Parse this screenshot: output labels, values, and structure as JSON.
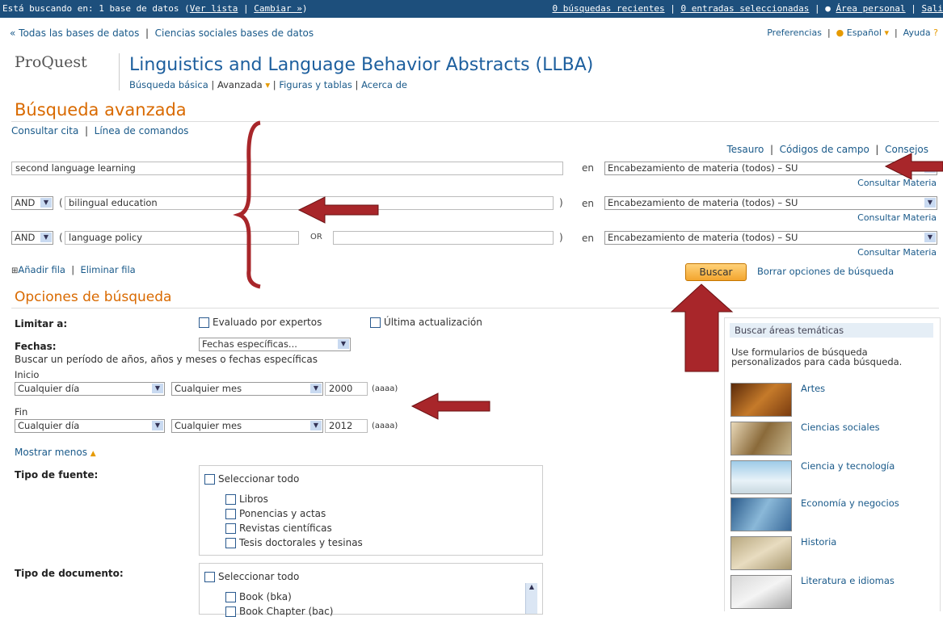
{
  "topbar": {
    "searching_prefix": "Está buscando en: 1 base de datos (",
    "ver_lista": "Ver lista",
    "sep": " | ",
    "cambiar": "Cambiar »",
    "searching_suffix": ")",
    "recent": "0 búsquedas recientes",
    "selected": "0 entradas seleccionadas",
    "personal": "Área personal",
    "exit": "Sali"
  },
  "nav": {
    "all_db": "« Todas las bases de datos",
    "social": "Ciencias sociales bases de datos",
    "prefs": "Preferencias",
    "lang": "Español",
    "help": "Ayuda"
  },
  "brand": {
    "logo": "ProQuest",
    "db_title": "Linguistics and Language Behavior Abstracts (LLBA)",
    "tabs": [
      "Búsqueda básica",
      "Avanzada",
      "Figuras y tablas",
      "Acerca de"
    ]
  },
  "page_title": "Búsqueda avanzada",
  "subnav": {
    "cite": "Consultar cita",
    "cmd": "Línea de comandos"
  },
  "tools": {
    "thesaurus": "Tesauro",
    "codes": "Códigos de campo",
    "tips": "Consejos"
  },
  "rows": [
    {
      "term1": "second language learning",
      "in": "en",
      "field": "Encabezamiento de materia (todos) – SU",
      "consult": "Consultar Materia"
    },
    {
      "op": "AND",
      "paren": "(",
      "term1": "bilingual education",
      "close": ")",
      "in": "en",
      "field": "Encabezamiento de materia (todos) – SU",
      "consult": "Consultar Materia"
    },
    {
      "op": "AND",
      "paren": "(",
      "term1": "language policy",
      "or": "OR",
      "term2": "",
      "close": ")",
      "in": "en",
      "field": "Encabezamiento de materia (todos) – SU",
      "consult": "Consultar Materia"
    }
  ],
  "row_actions": {
    "add": "Añadir fila",
    "remove": "Eliminar fila",
    "search": "Buscar",
    "clear": "Borrar opciones de búsqueda"
  },
  "options": {
    "title": "Opciones de búsqueda",
    "limit_label": "Limitar a:",
    "peer": "Evaluado por expertos",
    "latest": "Última actualización",
    "dates_label": "Fechas:",
    "dates_select": "Fechas específicas...",
    "dates_hint": "Buscar un período de años, años y meses o fechas específicas",
    "start_label": "Inicio",
    "end_label": "Fin",
    "start": {
      "day": "Cualquier día",
      "month": "Cualquier mes",
      "year": "2000",
      "fmt": "(aaaa)"
    },
    "end": {
      "day": "Cualquier día",
      "month": "Cualquier mes",
      "year": "2012",
      "fmt": "(aaaa)"
    },
    "show_less": "Mostrar menos",
    "source_label": "Tipo de fuente:",
    "source_items": [
      "Seleccionar todo",
      "Libros",
      "Ponencias y actas",
      "Revistas científicas",
      "Tesis doctorales y tesinas"
    ],
    "doc_label": "Tipo de documento:",
    "doc_items": [
      "Seleccionar todo",
      "Book (bka)",
      "Book Chapter (bac)"
    ]
  },
  "sidebar": {
    "header": "Buscar áreas temáticas",
    "desc": "Use formularios de búsqueda personalizados para cada búsqueda.",
    "areas": [
      "Artes",
      "Ciencias sociales",
      "Ciencia y tecnología",
      "Economía y negocios",
      "Historia",
      "Literatura e idiomas"
    ]
  },
  "colors": {
    "accent": "#d96a00",
    "link": "#1a5a8a",
    "topbar": "#1d4f7c",
    "annotation": "#a8262a"
  }
}
